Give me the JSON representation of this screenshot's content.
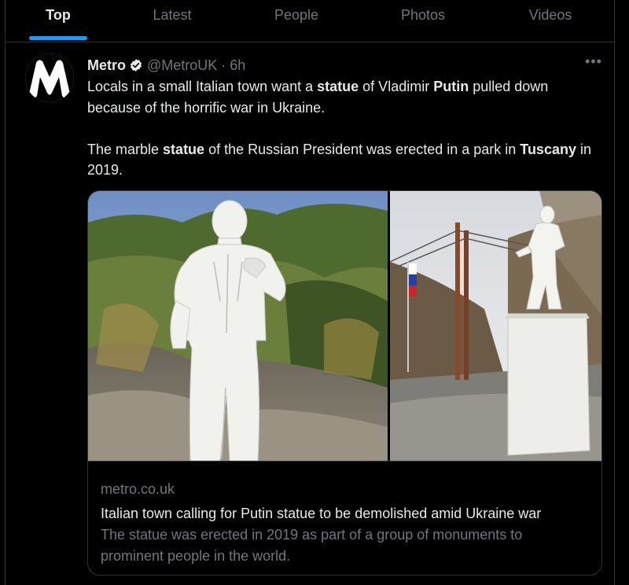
{
  "tabs": [
    {
      "label": "Top",
      "active": true
    },
    {
      "label": "Latest",
      "active": false
    },
    {
      "label": "People",
      "active": false
    },
    {
      "label": "Photos",
      "active": false
    },
    {
      "label": "Videos",
      "active": false
    }
  ],
  "tweet": {
    "author_name": "Metro",
    "handle": "@MetroUK",
    "separator": "·",
    "time": "6h",
    "more_label": "•••",
    "paragraph1": {
      "t1": "Locals in a small Italian town want a ",
      "b1": "statue",
      "t2": " of Vladimir ",
      "b2": "Putin",
      "t3": " pulled down because of the horrific war in Ukraine."
    },
    "paragraph2": {
      "t1": "The marble ",
      "b1": "statue",
      "t2": " of the Russian President was erected in a park in ",
      "b2": "Tuscany",
      "t3": " in 2019."
    }
  },
  "card": {
    "domain": "metro.co.uk",
    "title": "Italian town calling for Putin statue to be demolished amid Ukraine war",
    "description": "The statue was erected in 2019 as part of a group of monuments to prominent people in the world."
  },
  "icons": {
    "avatar": "metro-logo-icon",
    "verified": "verified-badge-icon",
    "more": "more-options-icon"
  },
  "colors": {
    "accent": "#1d9bf0",
    "text": "#e7e9ea",
    "muted": "#71767b",
    "border": "#2f3336",
    "background": "#000000"
  }
}
